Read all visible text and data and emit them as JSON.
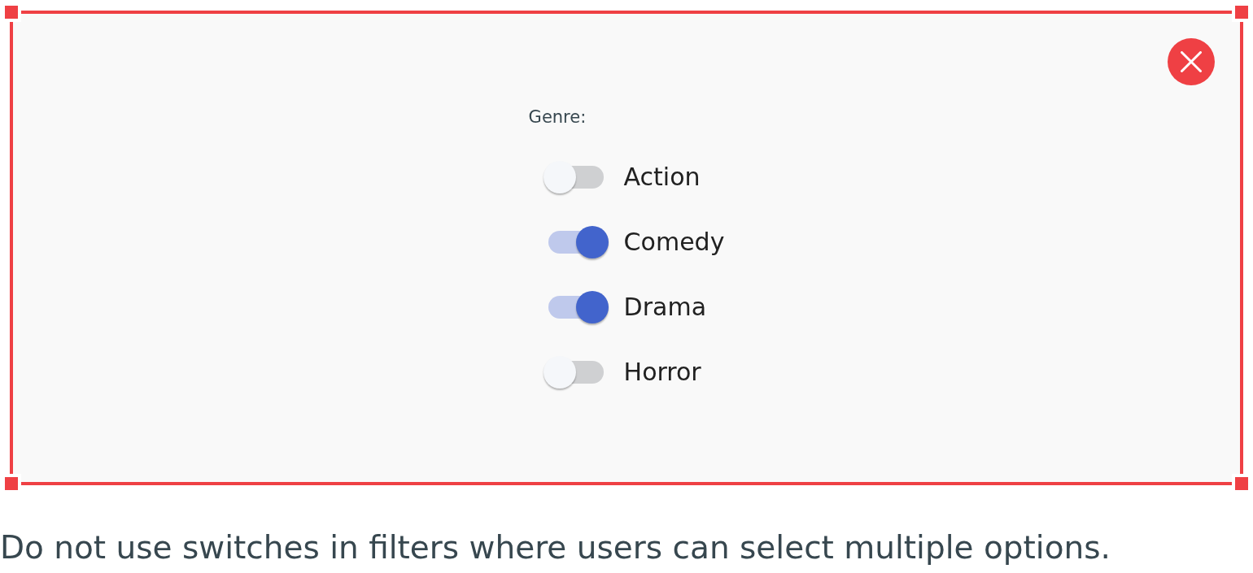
{
  "panel": {
    "group_label": "Genre:",
    "options": [
      {
        "label": "Action",
        "on": false
      },
      {
        "label": "Comedy",
        "on": true
      },
      {
        "label": "Drama",
        "on": true
      },
      {
        "label": "Horror",
        "on": false
      }
    ]
  },
  "caption": "Do not use switches in filters where users can select multiple options."
}
